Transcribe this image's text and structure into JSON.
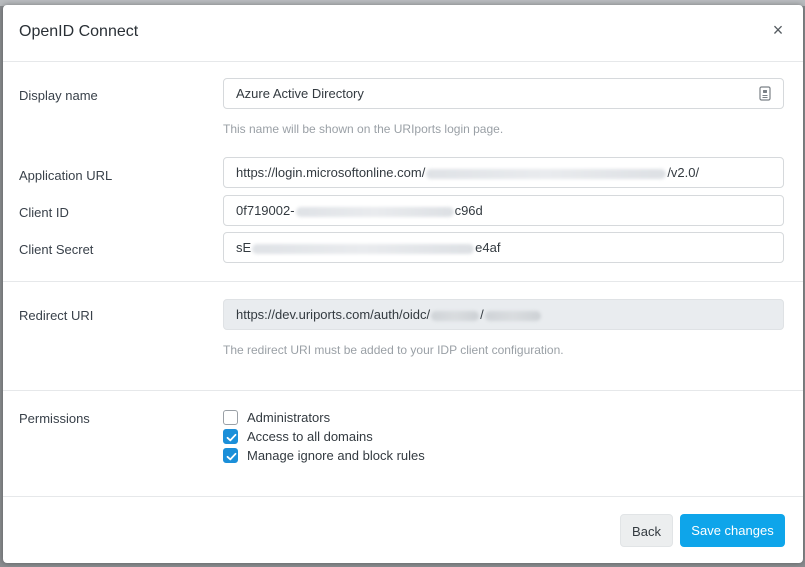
{
  "modal": {
    "title": "OpenID Connect",
    "close_glyph": "×"
  },
  "display_name": {
    "label": "Display name",
    "value": "Azure Active Directory",
    "help": "This name will be shown on the URIports login page."
  },
  "application_url": {
    "label": "Application URL",
    "prefix": "https://login.microsoftonline.com/",
    "suffix": "/v2.0/"
  },
  "client_id": {
    "label": "Client ID",
    "prefix": "0f719002-",
    "suffix": "c96d"
  },
  "client_secret": {
    "label": "Client Secret",
    "prefix": "sE",
    "suffix": "e4af"
  },
  "redirect_uri": {
    "label": "Redirect URI",
    "prefix": "https://dev.uriports.com/auth/oidc/",
    "separator": "/",
    "help": "The redirect URI must be added to your IDP client configuration."
  },
  "permissions": {
    "label": "Permissions",
    "options": [
      {
        "label": "Administrators",
        "checked": false
      },
      {
        "label": "Access to all domains",
        "checked": true
      },
      {
        "label": "Manage ignore and block rules",
        "checked": true
      }
    ]
  },
  "footer": {
    "back_label": "Back",
    "save_label": "Save changes"
  },
  "colors": {
    "primary": "#0ea5ea",
    "checkbox_checked": "#1b8fd9"
  }
}
